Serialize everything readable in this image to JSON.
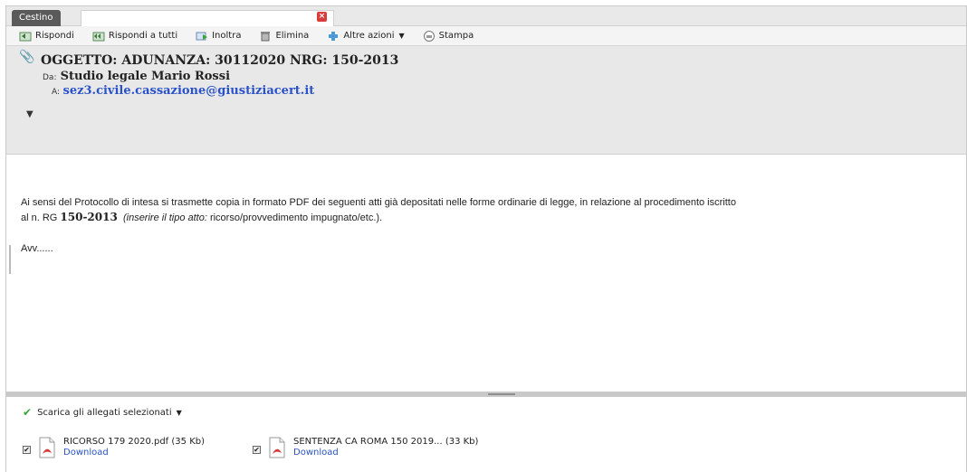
{
  "tab": {
    "label": "Cestino"
  },
  "toolbar": {
    "reply": "Rispondi",
    "reply_all": "Rispondi a tutti",
    "forward": "Inoltra",
    "delete": "Elimina",
    "more": "Altre azioni",
    "print": "Stampa"
  },
  "message": {
    "subject": "OGGETTO: ADUNANZA: 30112020 NRG: 150-2013",
    "from_label": "Da:",
    "from": "Studio legale Mario Rossi",
    "to_label": "A:",
    "to": "sez3.civile.cassazione@giustiziacert.it",
    "body_line1": "Ai sensi del Protocollo di intesa  si trasmette copia in formato PDF dei seguenti atti già depositati nelle forme ordinarie di legge, in relazione al procedimento iscritto",
    "body_prefix": "al n. RG ",
    "body_rg": "150-2013",
    "body_note": "(inserire il tipo atto: ",
    "body_note2": "ricorso/provvedimento impugnato/etc.).",
    "signature": "Avv......"
  },
  "attachments": {
    "download_selected": "Scarica gli allegati selezionati",
    "files": [
      {
        "name": "RICORSO 179 2020.pdf (35 Kb)",
        "link": "Download"
      },
      {
        "name": "SENTENZA CA ROMA 150 2019... (33 Kb)",
        "link": "Download"
      }
    ]
  },
  "colors": {
    "link": "#2a52c9",
    "accent_green": "#3aa43a",
    "close_red": "#d93a3a"
  }
}
